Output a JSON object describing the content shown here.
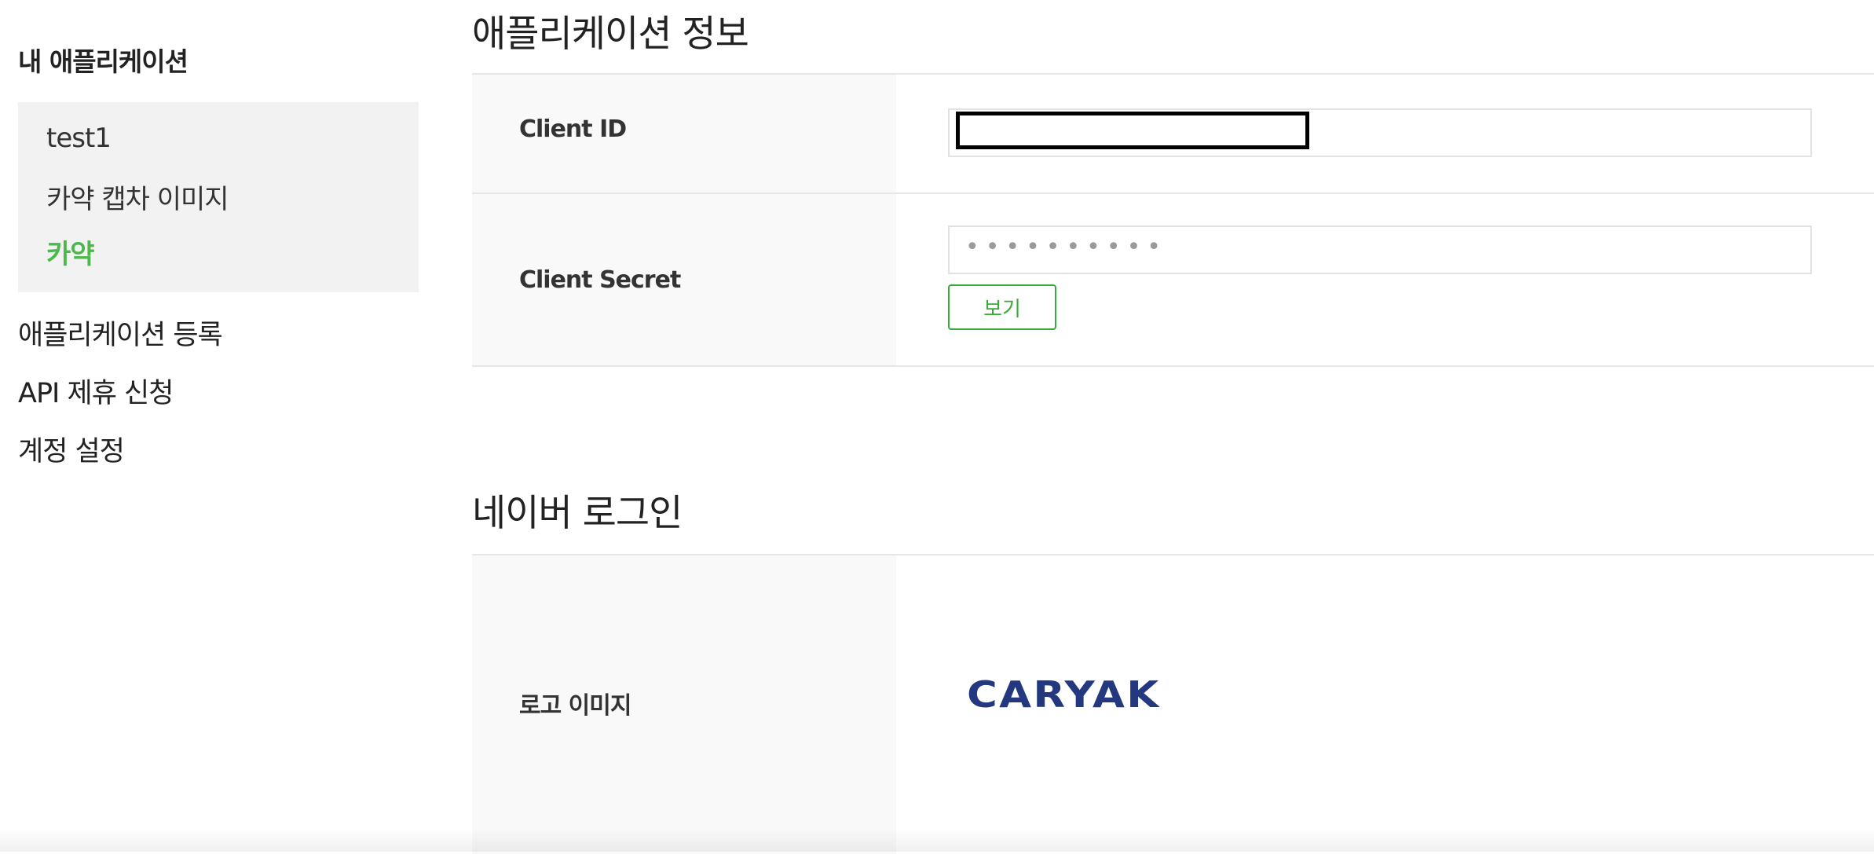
{
  "sidebar": {
    "heading": "내 애플리케이션",
    "apps": [
      {
        "label": "test1"
      },
      {
        "label": "카약 캡차 이미지"
      },
      {
        "label": "카약"
      }
    ],
    "nav": [
      {
        "label": "애플리케이션 등록"
      },
      {
        "label": "API 제휴 신청"
      },
      {
        "label": "계정 설정"
      }
    ]
  },
  "app_info": {
    "title": "애플리케이션 정보",
    "client_id_label": "Client ID",
    "client_secret_label": "Client Secret",
    "client_secret_masked": "••••••••••",
    "view_button_label": "보기"
  },
  "naver_login": {
    "title": "네이버 로그인",
    "logo_image_label": "로고 이미지",
    "logo_text": "CARYAK"
  },
  "colors": {
    "active_app": "#4cb84c",
    "button_green": "#3aaa3a",
    "logo_navy": "#24387f",
    "sidebar_bg": "#f2f2f2",
    "header_cell_bg": "#f9f9f9"
  }
}
